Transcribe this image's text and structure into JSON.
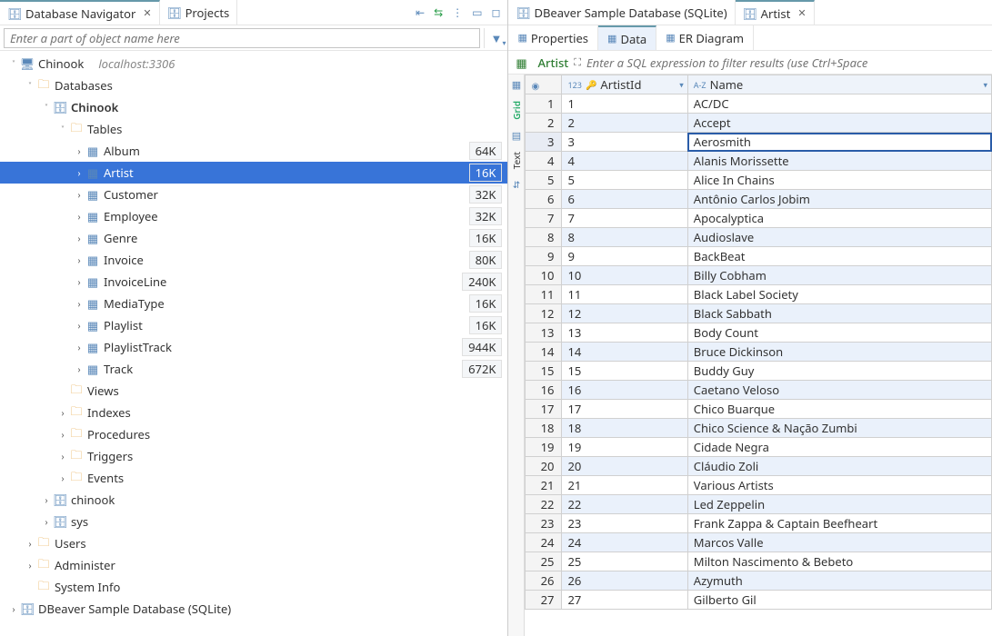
{
  "left": {
    "tabs": [
      {
        "label": "Database Navigator",
        "active": true,
        "closable": true
      },
      {
        "label": "Projects",
        "active": false,
        "closable": false
      }
    ],
    "search_placeholder": "Enter a part of object name here",
    "tree": [
      {
        "depth": 0,
        "twist": "˅",
        "icon": "db-icon",
        "label": "Chinook",
        "host": "localhost:3306"
      },
      {
        "depth": 1,
        "twist": "˅",
        "icon": "folder-icon",
        "label": "Databases"
      },
      {
        "depth": 2,
        "twist": "˅",
        "icon": "db-small-icon",
        "label": "Chinook",
        "bold": true
      },
      {
        "depth": 3,
        "twist": "˅",
        "icon": "folder-icon",
        "label": "Tables"
      },
      {
        "depth": 4,
        "twist": "›",
        "icon": "table-icon",
        "label": "Album",
        "size": "64K"
      },
      {
        "depth": 4,
        "twist": "›",
        "icon": "table-icon",
        "label": "Artist",
        "size": "16K",
        "selected": true
      },
      {
        "depth": 4,
        "twist": "›",
        "icon": "table-icon",
        "label": "Customer",
        "size": "32K"
      },
      {
        "depth": 4,
        "twist": "›",
        "icon": "table-icon",
        "label": "Employee",
        "size": "32K"
      },
      {
        "depth": 4,
        "twist": "›",
        "icon": "table-icon",
        "label": "Genre",
        "size": "16K"
      },
      {
        "depth": 4,
        "twist": "›",
        "icon": "table-icon",
        "label": "Invoice",
        "size": "80K"
      },
      {
        "depth": 4,
        "twist": "›",
        "icon": "table-icon",
        "label": "InvoiceLine",
        "size": "240K"
      },
      {
        "depth": 4,
        "twist": "›",
        "icon": "table-icon",
        "label": "MediaType",
        "size": "16K"
      },
      {
        "depth": 4,
        "twist": "›",
        "icon": "table-icon",
        "label": "Playlist",
        "size": "16K"
      },
      {
        "depth": 4,
        "twist": "›",
        "icon": "table-icon",
        "label": "PlaylistTrack",
        "size": "944K"
      },
      {
        "depth": 4,
        "twist": "›",
        "icon": "table-icon",
        "label": "Track",
        "size": "672K"
      },
      {
        "depth": 3,
        "twist": "",
        "icon": "folder-icon",
        "label": "Views"
      },
      {
        "depth": 3,
        "twist": "›",
        "icon": "folder2-icon",
        "label": "Indexes"
      },
      {
        "depth": 3,
        "twist": "›",
        "icon": "folder2-icon",
        "label": "Procedures"
      },
      {
        "depth": 3,
        "twist": "›",
        "icon": "folder2-icon",
        "label": "Triggers"
      },
      {
        "depth": 3,
        "twist": "›",
        "icon": "folder2-icon",
        "label": "Events"
      },
      {
        "depth": 2,
        "twist": "›",
        "icon": "db-small-icon",
        "label": "chinook"
      },
      {
        "depth": 2,
        "twist": "›",
        "icon": "db-small-icon",
        "label": "sys"
      },
      {
        "depth": 1,
        "twist": "›",
        "icon": "folder-icon",
        "label": "Users"
      },
      {
        "depth": 1,
        "twist": "›",
        "icon": "folder-icon",
        "label": "Administer"
      },
      {
        "depth": 1,
        "twist": "",
        "icon": "folder-icon",
        "label": "System Info"
      },
      {
        "depth": 0,
        "twist": "›",
        "icon": "dbsq-icon",
        "label": "DBeaver Sample Database (SQLite)"
      }
    ]
  },
  "right": {
    "editor_tabs": [
      {
        "label": "DBeaver Sample Database (SQLite)",
        "active": false
      },
      {
        "label": "Artist",
        "active": true,
        "closable": true
      }
    ],
    "subtabs": [
      {
        "label": "Properties",
        "active": false,
        "icon": "props-icon"
      },
      {
        "label": "Data",
        "active": true,
        "icon": "data-icon"
      },
      {
        "label": "ER Diagram",
        "active": false,
        "icon": "er-icon"
      }
    ],
    "filter": {
      "table_name": "Artist",
      "placeholder": "Enter a SQL expression to filter results (use Ctrl+Space"
    },
    "viewmodes": [
      "Grid",
      "Text"
    ],
    "columns": [
      {
        "name": "ArtistId",
        "type": "123",
        "pk": true
      },
      {
        "name": "Name",
        "type": "A-Z",
        "pk": false,
        "selected": true
      }
    ],
    "rows": [
      {
        "n": 1,
        "id": "1",
        "name": "AC/DC"
      },
      {
        "n": 2,
        "id": "2",
        "name": "Accept"
      },
      {
        "n": 3,
        "id": "3",
        "name": "Aerosmith",
        "selected": true
      },
      {
        "n": 4,
        "id": "4",
        "name": "Alanis Morissette"
      },
      {
        "n": 5,
        "id": "5",
        "name": "Alice In Chains"
      },
      {
        "n": 6,
        "id": "6",
        "name": "Antônio Carlos Jobim"
      },
      {
        "n": 7,
        "id": "7",
        "name": "Apocalyptica"
      },
      {
        "n": 8,
        "id": "8",
        "name": "Audioslave"
      },
      {
        "n": 9,
        "id": "9",
        "name": "BackBeat"
      },
      {
        "n": 10,
        "id": "10",
        "name": "Billy Cobham"
      },
      {
        "n": 11,
        "id": "11",
        "name": "Black Label Society"
      },
      {
        "n": 12,
        "id": "12",
        "name": "Black Sabbath"
      },
      {
        "n": 13,
        "id": "13",
        "name": "Body Count"
      },
      {
        "n": 14,
        "id": "14",
        "name": "Bruce Dickinson"
      },
      {
        "n": 15,
        "id": "15",
        "name": "Buddy Guy"
      },
      {
        "n": 16,
        "id": "16",
        "name": "Caetano Veloso"
      },
      {
        "n": 17,
        "id": "17",
        "name": "Chico Buarque"
      },
      {
        "n": 18,
        "id": "18",
        "name": "Chico Science & Nação Zumbi"
      },
      {
        "n": 19,
        "id": "19",
        "name": "Cidade Negra"
      },
      {
        "n": 20,
        "id": "20",
        "name": "Cláudio Zoli"
      },
      {
        "n": 21,
        "id": "21",
        "name": "Various Artists"
      },
      {
        "n": 22,
        "id": "22",
        "name": "Led Zeppelin"
      },
      {
        "n": 23,
        "id": "23",
        "name": "Frank Zappa & Captain Beefheart"
      },
      {
        "n": 24,
        "id": "24",
        "name": "Marcos Valle"
      },
      {
        "n": 25,
        "id": "25",
        "name": "Milton Nascimento & Bebeto"
      },
      {
        "n": 26,
        "id": "26",
        "name": "Azymuth"
      },
      {
        "n": 27,
        "id": "27",
        "name": "Gilberto Gil"
      }
    ]
  }
}
